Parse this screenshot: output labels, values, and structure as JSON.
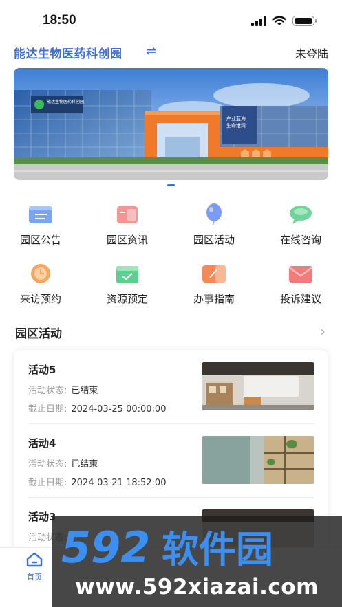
{
  "status_bar": {
    "time": "18:50"
  },
  "header": {
    "park_name": "能达生物医药科创园",
    "switch_glyph": "⇌",
    "login_status": "未登陆"
  },
  "banner": {
    "sign_left": "能达生物医药科创园",
    "sign_right_line1": "产业蓝海",
    "sign_right_line2": "生命港湾"
  },
  "quick_entries": [
    {
      "label": "园区公告",
      "icon": "announcement-icon",
      "color": "#6a9bf0"
    },
    {
      "label": "园区资讯",
      "icon": "news-icon",
      "color": "#f08a8a"
    },
    {
      "label": "园区活动",
      "icon": "balloon-icon",
      "color": "#7b9cf2"
    },
    {
      "label": "在线咨询",
      "icon": "chat-icon",
      "color": "#6fd39a"
    },
    {
      "label": "来访预约",
      "icon": "clock-icon",
      "color": "#f6a65e"
    },
    {
      "label": "资源预定",
      "icon": "calendar-icon",
      "color": "#5dcf8e"
    },
    {
      "label": "办事指南",
      "icon": "guide-icon",
      "color": "#f48a5a"
    },
    {
      "label": "投诉建议",
      "icon": "mail-icon",
      "color": "#f27c7c"
    }
  ],
  "section": {
    "title": "园区活动",
    "more_glyph": "›"
  },
  "activities": [
    {
      "title": "活动5",
      "status_label": "活动状态:",
      "status": "已结束",
      "deadline_label": "截止日期:",
      "deadline": "2024-03-25 00:00:00"
    },
    {
      "title": "活动4",
      "status_label": "活动状态:",
      "status": "已结束",
      "deadline_label": "截止日期:",
      "deadline": "2024-03-21 18:52:00"
    },
    {
      "title": "活动3",
      "status_label": "活动状态:",
      "status": "",
      "deadline_label": "",
      "deadline": ""
    }
  ],
  "tabbar": {
    "home_label": "首页"
  },
  "watermark": {
    "logo_text": "592软件园",
    "url": "www.592xiazai.com"
  },
  "colors": {
    "accent": "#3b6ee0",
    "orange": "#f07a2a"
  }
}
